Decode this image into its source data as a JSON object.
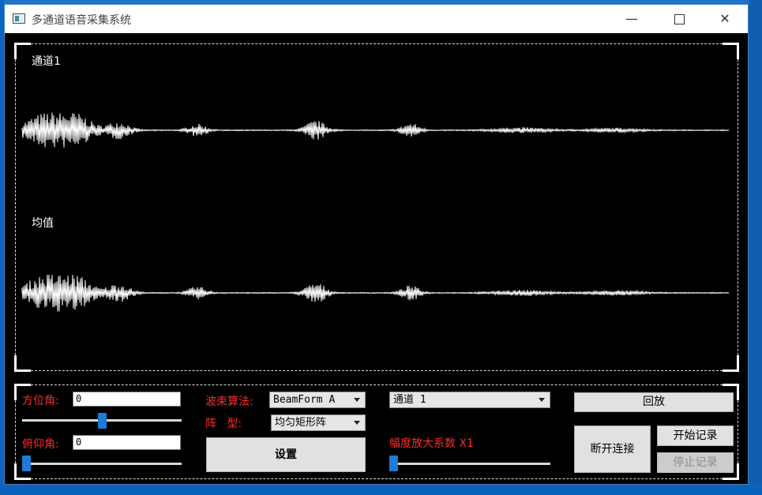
{
  "window": {
    "title": "多通道语音采集系统",
    "controls": {
      "minimize": "—",
      "close": "✕"
    }
  },
  "plot": {
    "channel_label": "通道1",
    "mean_label": "均值"
  },
  "controls": {
    "azimuth": {
      "label": "方位角:",
      "value": "0",
      "slider_fraction": 0.5
    },
    "pitch": {
      "label": "俯仰角:",
      "value": "0",
      "slider_fraction": 0.0
    },
    "beam_algo": {
      "label": "波束算法:",
      "value": "BeamForm A"
    },
    "array_type": {
      "label": "阵   型:",
      "value": "均匀矩形阵"
    },
    "set_button": "设置",
    "channel_select": {
      "value": "通道 1"
    },
    "gain": {
      "label": "幅度放大系数 X1",
      "slider_fraction": 0.0
    },
    "playback_button": "回放",
    "disconnect_button": "断开连接",
    "start_record_button": "开始记录",
    "stop_record_button": "停止记录"
  },
  "colors": {
    "label_red": "#ff2a2a",
    "slider_blue": "#1e7bd8",
    "plot_bg": "#000000",
    "wave": "#ffffff"
  }
}
